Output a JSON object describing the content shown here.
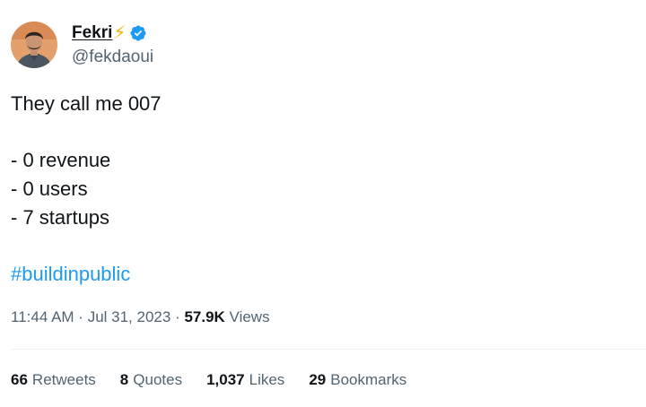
{
  "author": {
    "display_name": "Fekri",
    "emoji_icon": "lightning-bolt",
    "emoji_char": "⚡",
    "verified": true,
    "handle": "@fekdaoui"
  },
  "tweet": {
    "lines": [
      "They call me 007",
      "",
      "- 0 revenue",
      "- 0 users",
      "- 7 startups",
      "",
      "#buildinpublic"
    ],
    "hashtag": "#buildinpublic"
  },
  "meta": {
    "time": "11:44 AM",
    "separator": " · ",
    "date": "Jul 31, 2023",
    "views_count": "57.9K",
    "views_label": "Views"
  },
  "stats": [
    {
      "count": "66",
      "label": "Retweets"
    },
    {
      "count": "8",
      "label": "Quotes"
    },
    {
      "count": "1,037",
      "label": "Likes"
    },
    {
      "count": "29",
      "label": "Bookmarks"
    }
  ],
  "colors": {
    "text": "#0f1419",
    "secondary": "#536471",
    "link": "#1d9bf0",
    "verified_badge": "#1d9bf0",
    "divider": "#eff3f4"
  }
}
